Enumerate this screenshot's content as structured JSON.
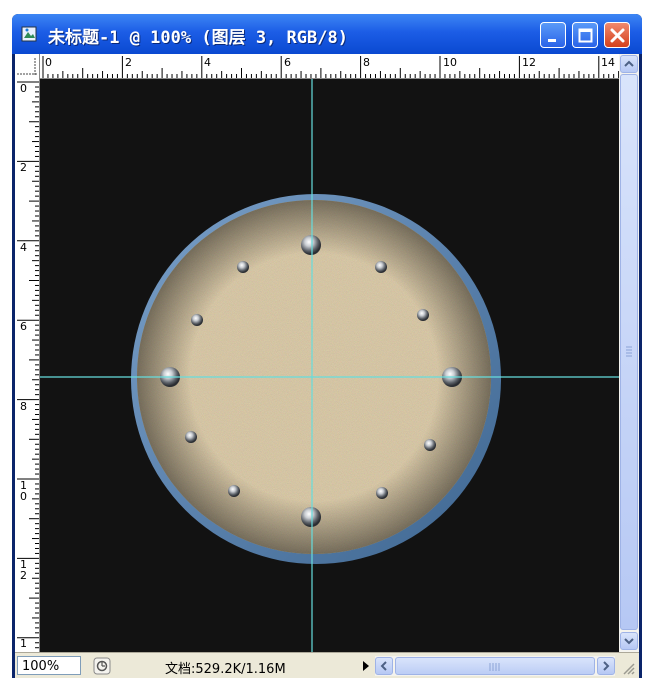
{
  "window": {
    "title": "未标题-1 @ 100% (图层 3, RGB/8)"
  },
  "rulers": {
    "top_labels": [
      "0",
      "2",
      "4",
      "6",
      "8",
      "10",
      "12",
      "14"
    ],
    "left_labels": [
      "0",
      "2",
      "4",
      "6",
      "8",
      "1\n0",
      "1\n2",
      "1"
    ]
  },
  "status": {
    "zoom": "100%",
    "doc_info": "文档:529.2K/1.16M"
  },
  "colors": {
    "title_bar": "#1c5de6",
    "canvas_bg": "#121212",
    "guide": "#66dddd",
    "disc_rim": "#5b82ad",
    "disc_fill": "#a49166"
  }
}
